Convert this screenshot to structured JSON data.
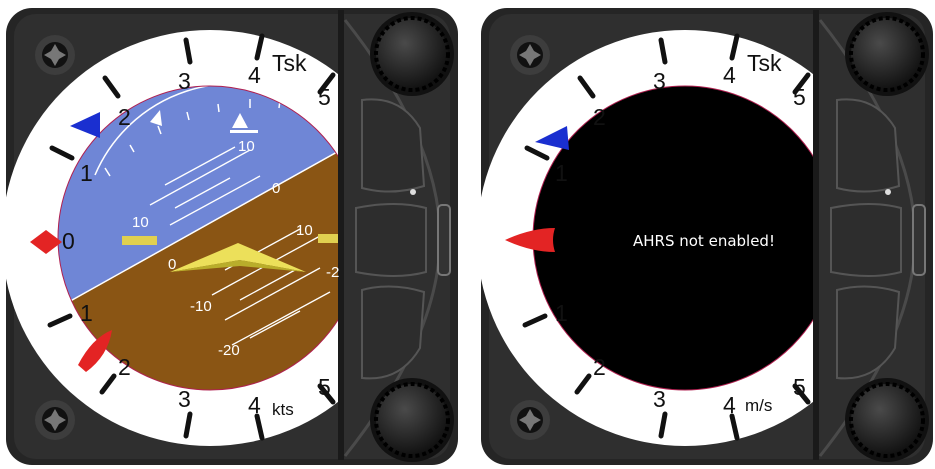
{
  "instruments": [
    {
      "scale_top": [
        "3",
        "4",
        "5",
        "2",
        "1",
        "0"
      ],
      "scale_bottom": [
        "1",
        "2",
        "3",
        "4",
        "5"
      ],
      "mode_label": "Tsk",
      "unit_label": "kts",
      "pitch_labels": [
        "10",
        "0",
        "10",
        "0",
        "10",
        "-10",
        "-20",
        "-2"
      ]
    },
    {
      "scale_top": [
        "3",
        "4",
        "5",
        "2",
        "1"
      ],
      "scale_bottom": [
        "1",
        "2",
        "3",
        "4",
        "5"
      ],
      "mode_label": "Tsk",
      "unit_label": "m/s",
      "message": "AHRS not enabled!"
    }
  ],
  "colors": {
    "sky": "#6f86d6",
    "ground": "#8a5514",
    "pointer_red": "#e32424",
    "marker_blue": "#1a2fd0",
    "aircraft_symbol": "#ece05a"
  },
  "icons": [
    "screw-icon",
    "knob-icon",
    "pointer-icon",
    "triangle-marker-icon",
    "aircraft-symbol-icon"
  ]
}
